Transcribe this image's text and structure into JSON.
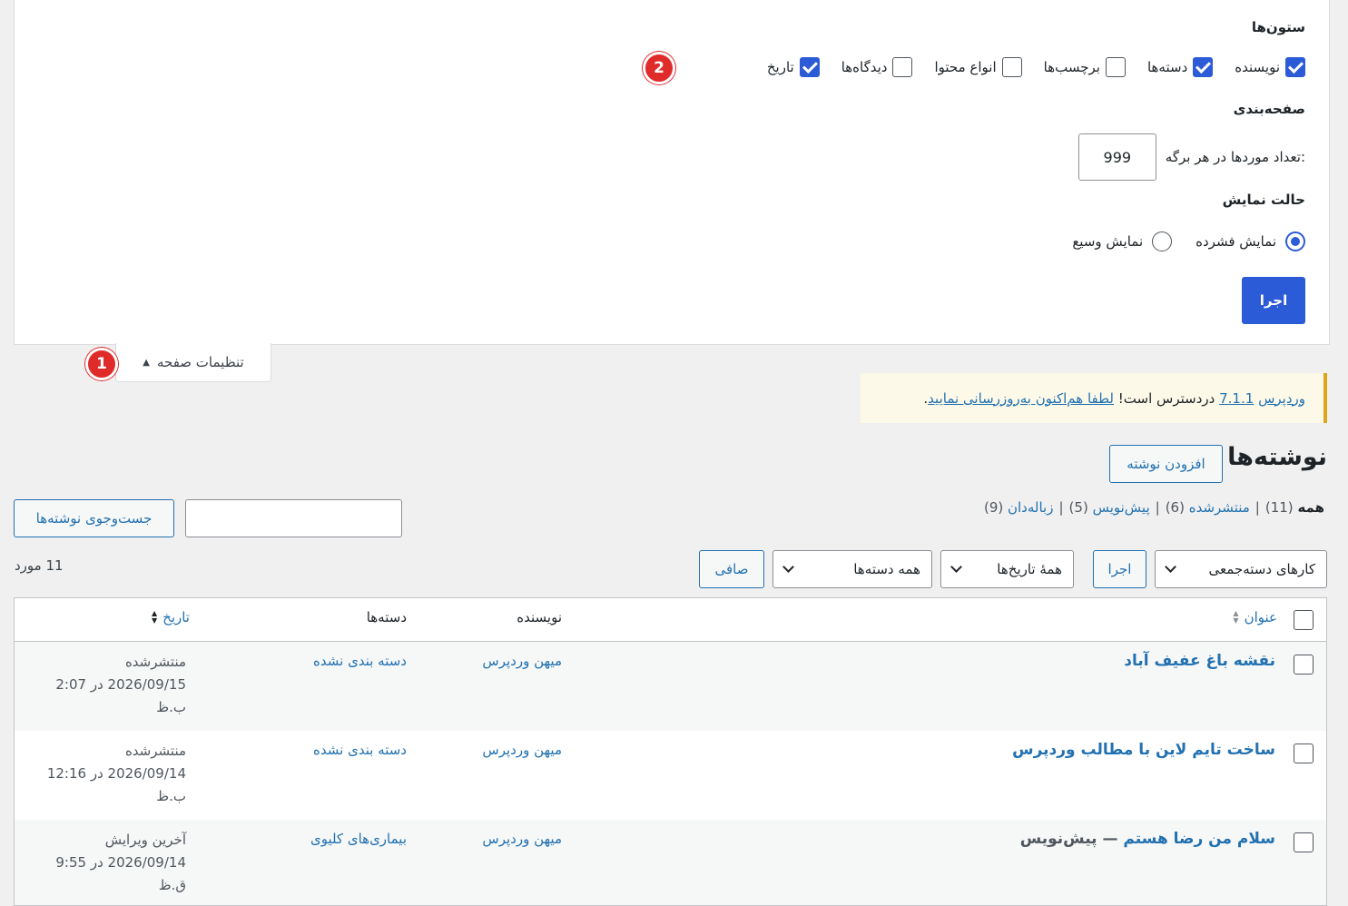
{
  "screen_options": {
    "columns_title": "ستون‌ها",
    "columns": [
      {
        "label": "نویسنده",
        "checked": true
      },
      {
        "label": "دسته‌ها",
        "checked": true
      },
      {
        "label": "برچسب‌ها",
        "checked": false
      },
      {
        "label": "انواع محتوا",
        "checked": false
      },
      {
        "label": "دیدگاه‌ها",
        "checked": false
      },
      {
        "label": "تاریخ",
        "checked": true
      }
    ],
    "pagination_title": "صفحه‌بندی",
    "items_per_page_label": "تعداد موردها در هر برگه:",
    "items_per_page_value": "999",
    "view_mode_title": "حالت نمایش",
    "view_modes": [
      {
        "label": "نمایش فشرده",
        "selected": true
      },
      {
        "label": "نمایش وسیع",
        "selected": false
      }
    ],
    "apply_label": "اجرا",
    "tab_label": "تنظیمات صفحه",
    "tab_arrow": "▲"
  },
  "annotations": {
    "badge1": "1",
    "badge2": "2"
  },
  "notice": {
    "prefix": "وردپرس",
    "version_link": "7.1.1",
    "middle": "دردسترس است!",
    "update_link": "لطفا هم‌اکنون به‌روزرسانی نمایید",
    "suffix": "."
  },
  "page": {
    "title": "نوشته‌ها",
    "add_new": "افزودن نوشته",
    "search_button": "جست‌وجوی نوشته‌ها",
    "search_value": ""
  },
  "subsubsub": [
    {
      "label": "همه",
      "count": "(11)",
      "current": true
    },
    {
      "label": "منتشرشده",
      "count": "(6)",
      "current": false
    },
    {
      "label": "پیش‌نویس",
      "count": "(5)",
      "current": false
    },
    {
      "label": "زباله‌دان",
      "count": "(9)",
      "current": false
    }
  ],
  "filters": {
    "bulk_actions": "کارهای دسته‌جمعی",
    "apply": "اجرا",
    "all_dates": "همهٔ تاریخ‌ها",
    "all_categories": "همه دسته‌ها",
    "filter": "صافی",
    "items_count": "11 مورد"
  },
  "table": {
    "headers": {
      "title": "عنوان",
      "author": "نویسنده",
      "categories": "دسته‌ها",
      "date": "تاریخ"
    },
    "rows": [
      {
        "title": "نقشه باغ عفیف آباد",
        "status_suffix": "",
        "author": "میهن وردپرس",
        "category": "دسته بندی نشده",
        "date_status": "منتشرشده",
        "date": "2026/09/15 در 2:07",
        "date_period": "ب.ظ"
      },
      {
        "title": "ساخت تایم لاین با مطالب وردپرس",
        "status_suffix": "",
        "author": "میهن وردپرس",
        "category": "دسته بندی نشده",
        "date_status": "منتشرشده",
        "date": "2026/09/14 در 12:16",
        "date_period": "ب.ظ"
      },
      {
        "title": "سلام من رضا هستم",
        "status_suffix": "— پیش‌نویس",
        "author": "میهن وردپرس",
        "category": "بیماری‌های کلیوی",
        "date_status": "آخرین ویرایش",
        "date": "2026/09/14 در 9:55",
        "date_period": "ق.ظ"
      }
    ]
  }
}
